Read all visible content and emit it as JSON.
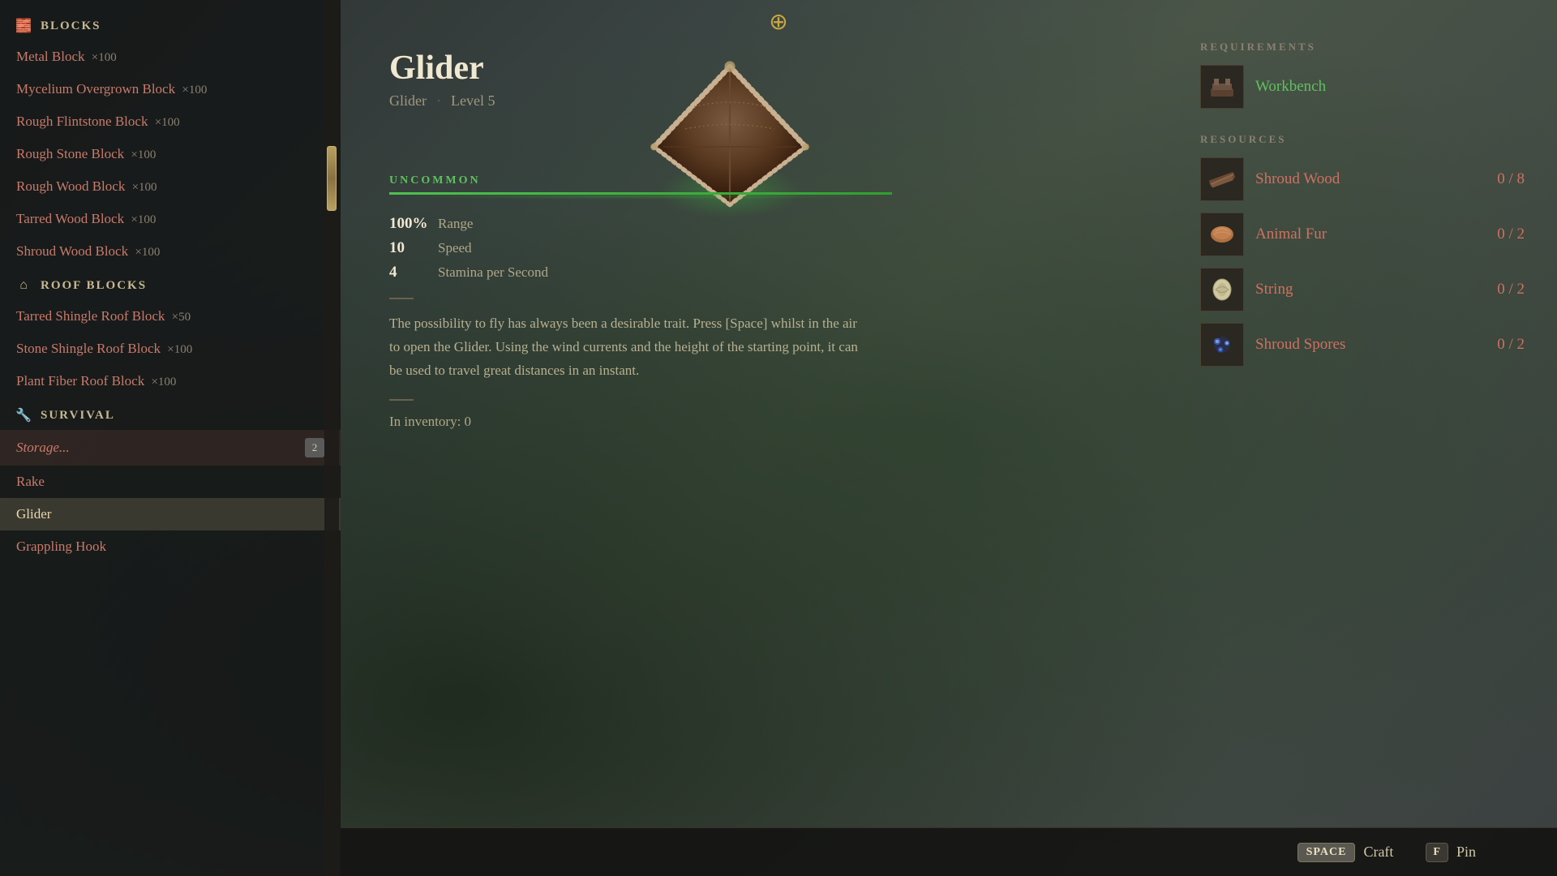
{
  "sidebar": {
    "categories": [
      {
        "id": "blocks",
        "label": "BLOCKS",
        "icon": "🧱",
        "items": [
          {
            "name": "Metal Block",
            "qty": "×100",
            "active": false
          },
          {
            "name": "Mycelium Overgrown Block",
            "qty": "×100",
            "active": false
          },
          {
            "name": "Rough Flintstone Block",
            "qty": "×100",
            "active": false
          },
          {
            "name": "Rough Stone Block",
            "qty": "×100",
            "active": false
          },
          {
            "name": "Rough Wood Block",
            "qty": "×100",
            "active": false
          },
          {
            "name": "Tarred Wood Block",
            "qty": "×100",
            "active": false
          },
          {
            "name": "Shroud Wood Block",
            "qty": "×100",
            "active": false
          }
        ]
      },
      {
        "id": "roof-blocks",
        "label": "ROOF BLOCKS",
        "icon": "🏠",
        "items": [
          {
            "name": "Tarred Shingle Roof Block",
            "qty": "×50",
            "active": false
          },
          {
            "name": "Stone Shingle Roof Block",
            "qty": "×100",
            "active": false
          },
          {
            "name": "Plant Fiber Roof Block",
            "qty": "×100",
            "active": false
          }
        ]
      },
      {
        "id": "survival",
        "label": "SURVIVAL",
        "icon": "🔧",
        "items": [
          {
            "name": "Storage...",
            "qty": "",
            "active": false,
            "storage": true,
            "badge": "2"
          },
          {
            "name": "Rake",
            "qty": "",
            "active": false
          },
          {
            "name": "Glider",
            "qty": "",
            "active": true
          },
          {
            "name": "Grappling Hook",
            "qty": "",
            "active": false
          }
        ]
      }
    ]
  },
  "detail": {
    "name": "Glider",
    "subtitle_type": "Glider",
    "subtitle_level": "Level 5",
    "rarity": "UNCOMMON",
    "stats": [
      {
        "value": "100%",
        "label": "Range"
      },
      {
        "value": "10",
        "label": "Speed"
      },
      {
        "value": "4",
        "label": "Stamina per Second"
      }
    ],
    "description": "The possibility to fly has always been a desirable trait. Press [Space] whilst in the air to open the Glider. Using the wind currents and the height of the starting point, it can be used to travel great distances in an instant.",
    "inventory": "In inventory: 0"
  },
  "requirements": {
    "section_title": "REQUIREMENTS",
    "workbench_label": "Workbench",
    "resources_title": "RESOURCES",
    "resources": [
      {
        "name": "Shroud Wood",
        "have": "0",
        "need": "8",
        "icon": "🪵",
        "color": "#d07060"
      },
      {
        "name": "Animal Fur",
        "have": "0",
        "need": "2",
        "icon": "🍂",
        "color": "#d07060"
      },
      {
        "name": "String",
        "have": "0",
        "need": "2",
        "icon": "🧶",
        "color": "#d07060"
      },
      {
        "name": "Shroud Spores",
        "have": "0",
        "need": "2",
        "icon": "✨",
        "color": "#d07060"
      }
    ]
  },
  "bottom_bar": {
    "craft_key": "SPACE",
    "craft_label": "Craft",
    "pin_key": "F",
    "pin_label": "Pin"
  }
}
